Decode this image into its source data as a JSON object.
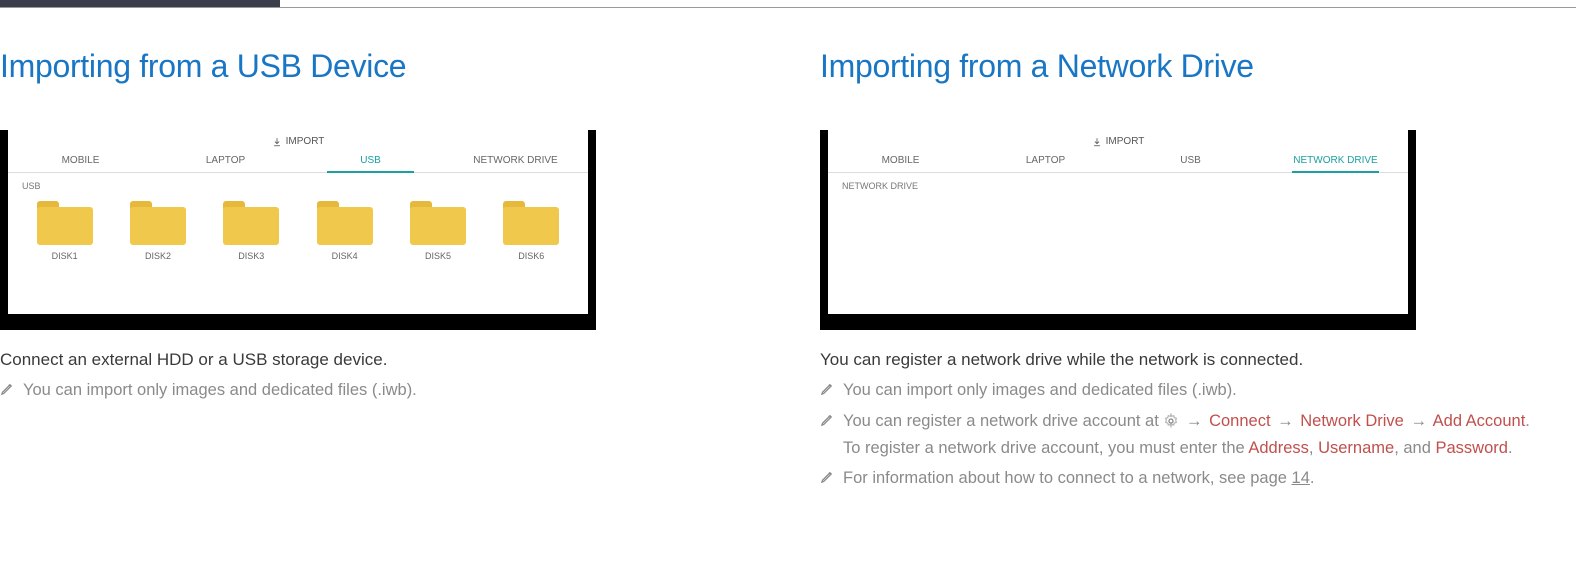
{
  "left": {
    "title": "Importing from a USB Device",
    "import_label": "IMPORT",
    "tabs": [
      "MOBILE",
      "LAPTOP",
      "USB",
      "NETWORK DRIVE"
    ],
    "active_tab_index": 2,
    "sub_label": "USB",
    "folders": [
      "DISK1",
      "DISK2",
      "DISK3",
      "DISK4",
      "DISK5",
      "DISK6"
    ],
    "body": "Connect an external HDD or a USB storage device.",
    "note1": "You can import only images and dedicated files (.iwb)."
  },
  "right": {
    "title": "Importing from a Network Drive",
    "import_label": "IMPORT",
    "tabs": [
      "MOBILE",
      "LAPTOP",
      "USB",
      "NETWORK DRIVE"
    ],
    "active_tab_index": 3,
    "sub_label": "NETWORK DRIVE",
    "body": "You can register a network drive while the network is connected.",
    "note1": "You can import only images and dedicated files (.iwb).",
    "note2_prefix": "You can register a network drive account at ",
    "note2_path": {
      "p1": "Connect",
      "p2": "Network Drive",
      "p3": "Add Account"
    },
    "note2_line2_a": "To register a network drive account, you must enter the ",
    "note2_addr": "Address",
    "note2_sep1": ", ",
    "note2_user": "Username",
    "note2_sep2": ", and ",
    "note2_pass": "Password",
    "note2_end": ".",
    "note3_a": "For information about how to connect to a network, see page ",
    "note3_page": "14",
    "note3_b": "."
  },
  "arrow": "→"
}
